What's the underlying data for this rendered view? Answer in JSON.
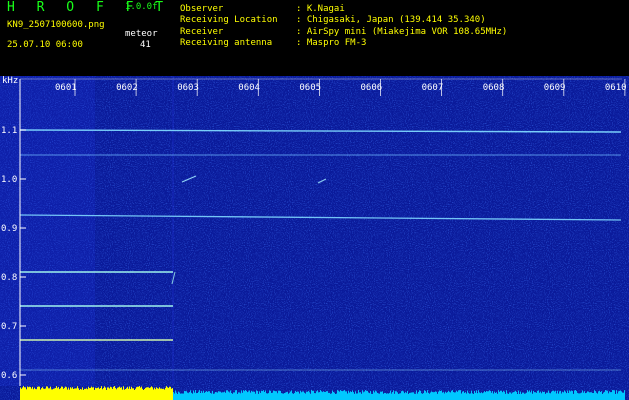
{
  "app": {
    "title": "H R O F F T",
    "version": "1.0.0f"
  },
  "file": {
    "name": "KN9_2507100600.png",
    "datetime": "25.07.10 06:00"
  },
  "counter": {
    "label": "meteor",
    "value": "41"
  },
  "info": {
    "rows": [
      {
        "label": "Observer",
        "value": ": K.Nagai"
      },
      {
        "label": "Receiving Location",
        "value": ": Chigasaki, Japan (139.414 35.340)"
      },
      {
        "label": "Receiver",
        "value": ": AirSpy mini (Miakejima VOR 108.65MHz)"
      },
      {
        "label": "Receiving antenna",
        "value": ": Maspro FM-3"
      }
    ]
  },
  "axis": {
    "y_unit": "kHz",
    "y_ticks": [
      "1.1",
      "1.0",
      "0.9",
      "0.8",
      "0.7",
      "0.6"
    ],
    "x_ticks": [
      "0601",
      "0602",
      "0603",
      "0604",
      "0605",
      "0606",
      "0607",
      "0608",
      "0609",
      "0610"
    ]
  },
  "colors": {
    "background": "#000000",
    "plot_bg": "#0a1a9a",
    "header_green": "#19ff19",
    "header_yellow": "#ffff00",
    "signal_line": "#7fd8ff",
    "bottom_bar_a": "#ffff00",
    "bottom_bar_b": "#00c8ff"
  }
}
